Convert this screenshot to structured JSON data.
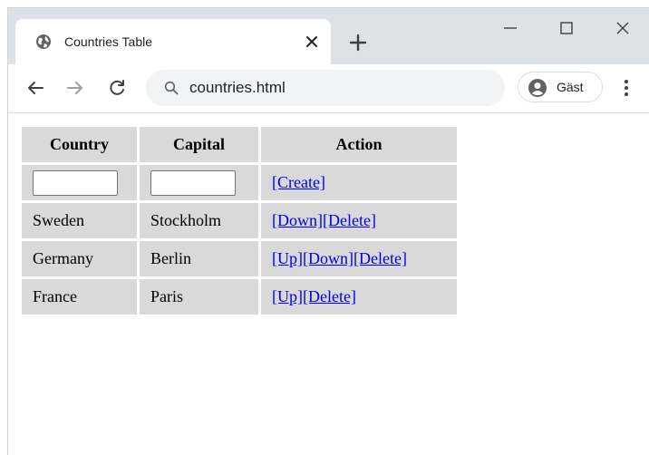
{
  "browser": {
    "tab_title": "Countries Table",
    "url": "countries.html",
    "profile_label": "Gäst",
    "icons": {
      "favicon": "globe-icon",
      "tab_close": "close-icon",
      "new_tab": "plus-icon",
      "back": "arrow-left-icon",
      "forward": "arrow-right-icon",
      "reload": "reload-icon",
      "search": "search-icon",
      "profile": "person-icon",
      "menu": "kebab-menu-icon",
      "minimize": "minimize-icon",
      "maximize": "maximize-icon",
      "close": "close-icon"
    }
  },
  "table": {
    "headers": {
      "country": "Country",
      "capital": "Capital",
      "action": "Action"
    },
    "create_row": {
      "country_value": "",
      "capital_value": "",
      "create_label": "[Create]"
    },
    "rows": [
      {
        "country": "Sweden",
        "capital": "Stockholm",
        "down": "[Down]",
        "delete": "[Delete]"
      },
      {
        "country": "Germany",
        "capital": "Berlin",
        "up": "[Up]",
        "down": "[Down]",
        "delete": "[Delete]"
      },
      {
        "country": "France",
        "capital": "Paris",
        "up": "[Up]",
        "delete": "[Delete]"
      }
    ]
  },
  "colors": {
    "link": "#0000ee",
    "cell_background": "#d9d9d9",
    "tabstrip": "#dee1e6",
    "omnibox": "#f1f3f4"
  }
}
